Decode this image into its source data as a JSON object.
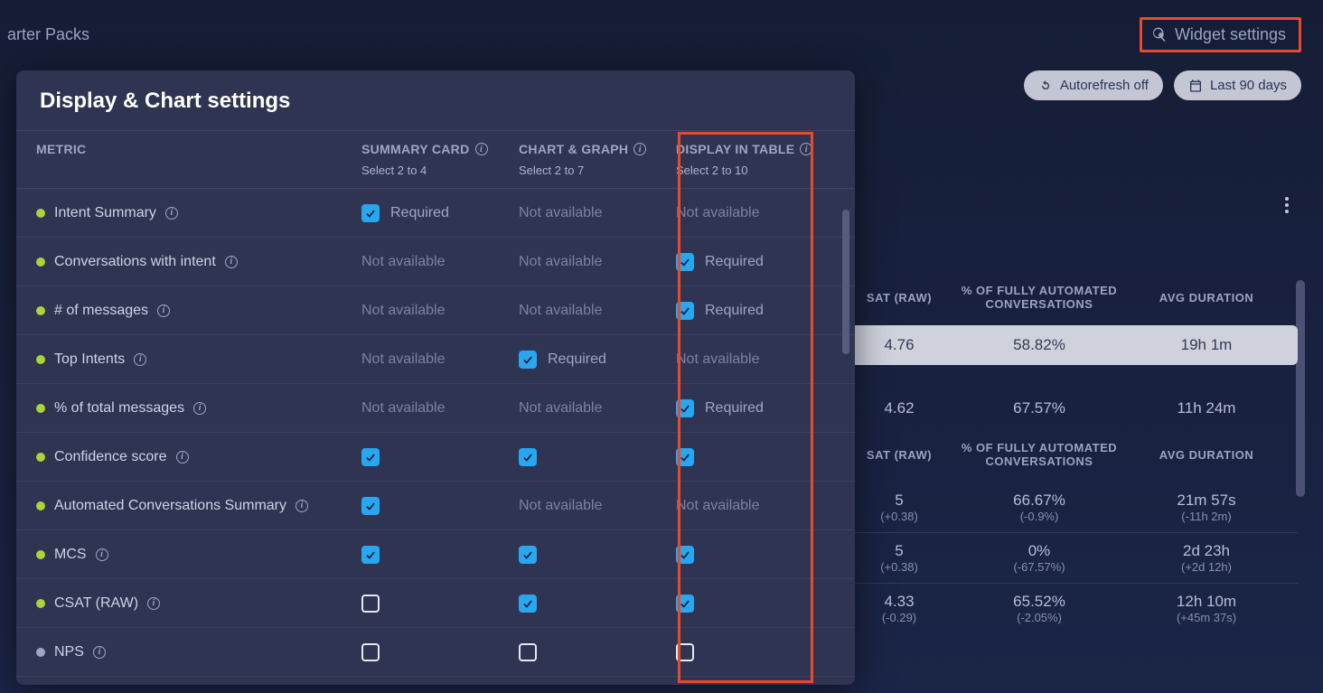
{
  "header": {
    "breadcrumb_fragment": "arter Packs",
    "widget_settings_label": "Widget settings"
  },
  "controls": {
    "autorefresh_label": "Autorefresh off",
    "daterange_label": "Last 90 days"
  },
  "modal": {
    "title": "Display & Chart settings",
    "columns": {
      "metric": "METRIC",
      "summary": {
        "label": "SUMMARY CARD",
        "sub": "Select 2 to 4"
      },
      "chart": {
        "label": "CHART & GRAPH",
        "sub": "Select 2 to 7"
      },
      "display": {
        "label": "DISPLAY IN TABLE",
        "sub": "Select 2 to 10"
      }
    },
    "required_label": "Required",
    "na_label": "Not available",
    "rows": [
      {
        "name": "Intent Summary",
        "dot": "green",
        "summary": "required",
        "chart": "na",
        "display": "na"
      },
      {
        "name": "Conversations with intent",
        "dot": "green",
        "summary": "na",
        "chart": "na",
        "display": "required"
      },
      {
        "name": "# of messages",
        "dot": "green",
        "summary": "na",
        "chart": "na",
        "display": "required"
      },
      {
        "name": "Top Intents",
        "dot": "green",
        "summary": "na",
        "chart": "required",
        "display": "na"
      },
      {
        "name": "% of total messages",
        "dot": "green",
        "summary": "na",
        "chart": "na",
        "display": "required"
      },
      {
        "name": "Confidence score",
        "dot": "green",
        "summary": "checked",
        "chart": "checked",
        "display": "checked"
      },
      {
        "name": "Automated Conversations Summary",
        "dot": "green",
        "summary": "checked",
        "chart": "na",
        "display": "na"
      },
      {
        "name": "MCS",
        "dot": "green",
        "summary": "checked",
        "chart": "checked",
        "display": "checked"
      },
      {
        "name": "CSAT (RAW)",
        "dot": "green",
        "summary": "unchecked",
        "chart": "checked",
        "display": "checked"
      },
      {
        "name": "NPS",
        "dot": "grey",
        "summary": "unchecked",
        "chart": "unchecked",
        "display": "unchecked"
      }
    ]
  },
  "background_table": {
    "headers": {
      "csat": "SAT (RAW)",
      "auto": "% OF FULLY AUTOMATED CONVERSATIONS",
      "dur": "AVG DURATION"
    },
    "summary_band": {
      "csat": "4.76",
      "auto": "58.82%",
      "dur": "19h 1m"
    },
    "subtotal_row": {
      "csat": "4.62",
      "auto": "67.57%",
      "dur": "11h 24m"
    },
    "rows": [
      {
        "csat": "5",
        "csat_delta": "(+0.38)",
        "auto": "66.67%",
        "auto_delta": "(-0.9%)",
        "dur": "21m 57s",
        "dur_delta": "(-11h 2m)"
      },
      {
        "csat": "5",
        "csat_delta": "(+0.38)",
        "auto": "0%",
        "auto_delta": "(-67.57%)",
        "dur": "2d 23h",
        "dur_delta": "(+2d 12h)"
      },
      {
        "csat": "4.33",
        "csat_delta": "(-0.29)",
        "auto": "65.52%",
        "auto_delta": "(-2.05%)",
        "dur": "12h 10m",
        "dur_delta": "(+45m 37s)"
      }
    ]
  }
}
